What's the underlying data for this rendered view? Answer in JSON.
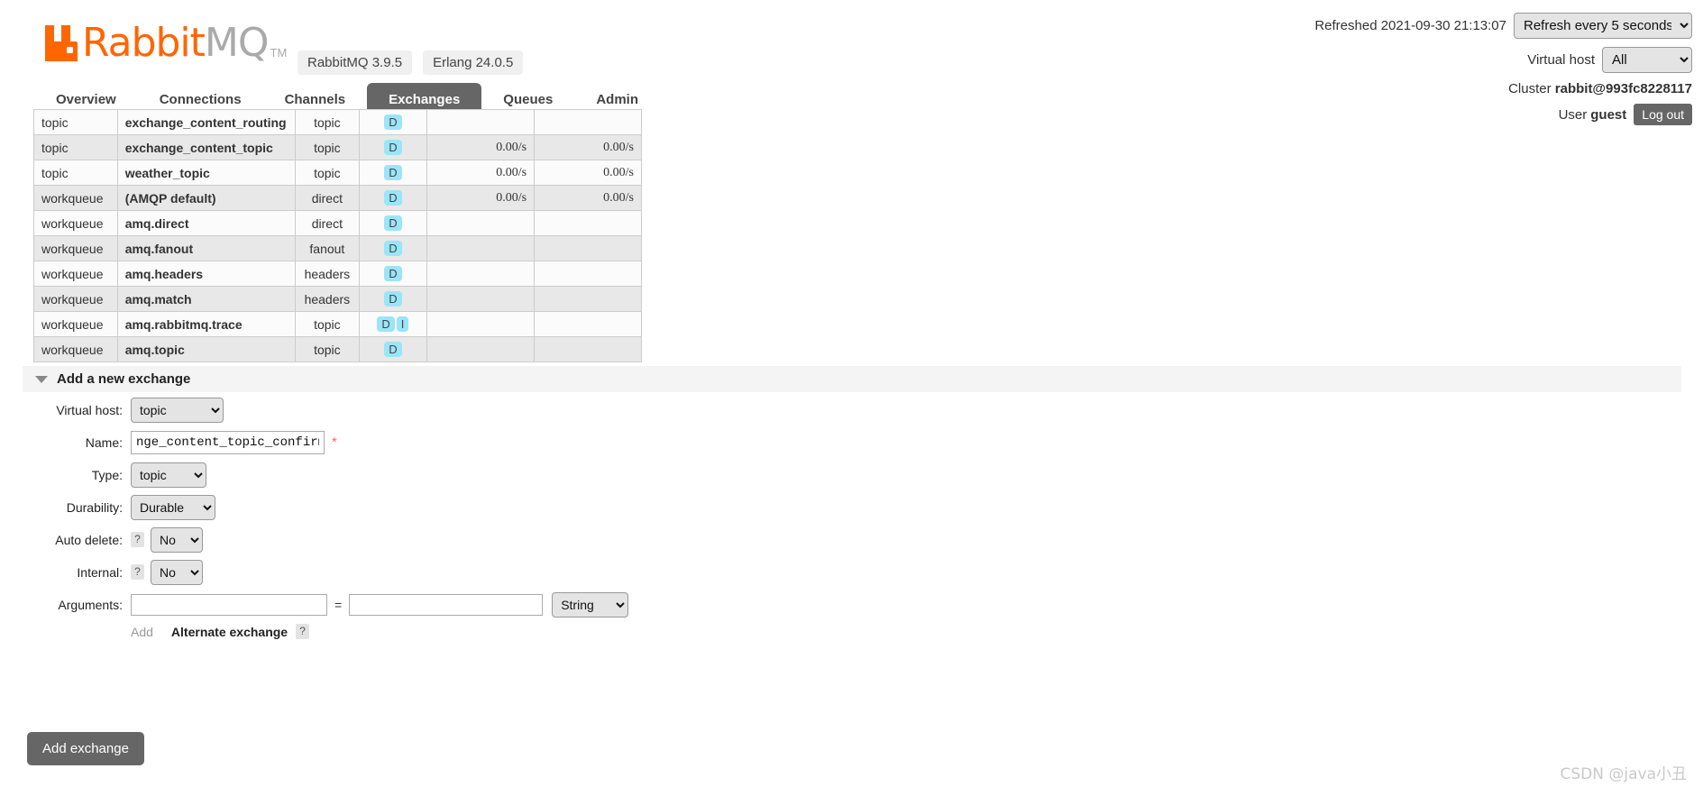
{
  "brand": {
    "name_primary": "Rabbit",
    "name_secondary": "MQ",
    "tm": "TM",
    "badges": [
      "RabbitMQ 3.9.5",
      "Erlang 24.0.5"
    ]
  },
  "header": {
    "refreshed_label": "Refreshed 2021-09-30 21:13:07",
    "refresh_select": "Refresh every 5 seconds",
    "vhost_label": "Virtual host",
    "vhost_select": "All",
    "cluster_label": "Cluster",
    "cluster_name": "rabbit@993fc8228117",
    "user_label": "User",
    "user_name": "guest",
    "logout_label": "Log out"
  },
  "nav": {
    "items": [
      {
        "label": "Overview",
        "active": false
      },
      {
        "label": "Connections",
        "active": false
      },
      {
        "label": "Channels",
        "active": false
      },
      {
        "label": "Exchanges",
        "active": true
      },
      {
        "label": "Queues",
        "active": false
      },
      {
        "label": "Admin",
        "active": false
      }
    ]
  },
  "table": {
    "rows": [
      {
        "vhost": "topic",
        "name": "exchange_content_routing",
        "type": "topic",
        "features": [
          "D"
        ],
        "rate_in": "",
        "rate_out": ""
      },
      {
        "vhost": "topic",
        "name": "exchange_content_topic",
        "type": "topic",
        "features": [
          "D"
        ],
        "rate_in": "0.00/s",
        "rate_out": "0.00/s"
      },
      {
        "vhost": "topic",
        "name": "weather_topic",
        "type": "topic",
        "features": [
          "D"
        ],
        "rate_in": "0.00/s",
        "rate_out": "0.00/s"
      },
      {
        "vhost": "workqueue",
        "name": "(AMQP default)",
        "type": "direct",
        "features": [
          "D"
        ],
        "rate_in": "0.00/s",
        "rate_out": "0.00/s"
      },
      {
        "vhost": "workqueue",
        "name": "amq.direct",
        "type": "direct",
        "features": [
          "D"
        ],
        "rate_in": "",
        "rate_out": ""
      },
      {
        "vhost": "workqueue",
        "name": "amq.fanout",
        "type": "fanout",
        "features": [
          "D"
        ],
        "rate_in": "",
        "rate_out": ""
      },
      {
        "vhost": "workqueue",
        "name": "amq.headers",
        "type": "headers",
        "features": [
          "D"
        ],
        "rate_in": "",
        "rate_out": ""
      },
      {
        "vhost": "workqueue",
        "name": "amq.match",
        "type": "headers",
        "features": [
          "D"
        ],
        "rate_in": "",
        "rate_out": ""
      },
      {
        "vhost": "workqueue",
        "name": "amq.rabbitmq.trace",
        "type": "topic",
        "features": [
          "D",
          "I"
        ],
        "rate_in": "",
        "rate_out": ""
      },
      {
        "vhost": "workqueue",
        "name": "amq.topic",
        "type": "topic",
        "features": [
          "D"
        ],
        "rate_in": "",
        "rate_out": ""
      }
    ]
  },
  "form": {
    "section_title": "Add a new exchange",
    "vhost_label": "Virtual host:",
    "vhost_value": "topic",
    "name_label": "Name:",
    "name_value": "nge_content_topic_confirm",
    "required_mark": "*",
    "type_label": "Type:",
    "type_value": "topic",
    "durability_label": "Durability:",
    "durability_value": "Durable",
    "autodelete_label": "Auto delete:",
    "autodelete_value": "No",
    "internal_label": "Internal:",
    "internal_value": "No",
    "arguments_label": "Arguments:",
    "arg_key_value": "",
    "arg_val_value": "",
    "equals": "=",
    "arg_type_value": "String",
    "help_mark": "?",
    "add_link": "Add",
    "alternate_exchange": "Alternate exchange",
    "submit_label": "Add exchange"
  },
  "watermark": "CSDN @java小丑"
}
